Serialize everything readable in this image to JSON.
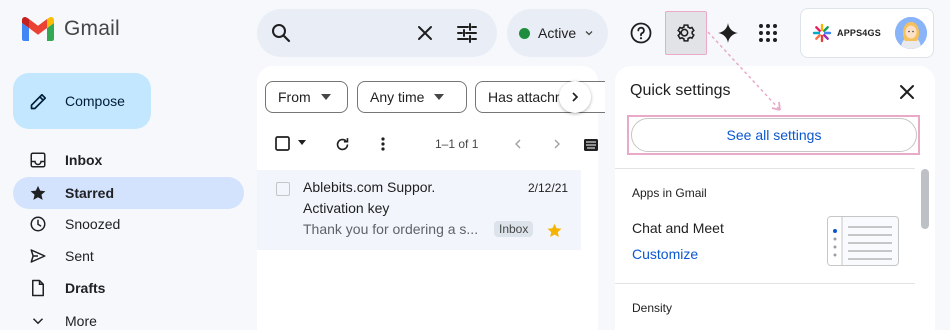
{
  "app": {
    "name": "Gmail"
  },
  "header": {
    "status_label": "Active",
    "account_label": "APPS4GS"
  },
  "sidebar": {
    "compose_label": "Compose",
    "items": [
      {
        "label": "Inbox",
        "icon": "inbox-icon",
        "bold": true
      },
      {
        "label": "Starred",
        "icon": "star-icon",
        "bold": true,
        "active": true
      },
      {
        "label": "Snoozed",
        "icon": "clock-icon"
      },
      {
        "label": "Sent",
        "icon": "send-icon"
      },
      {
        "label": "Drafts",
        "icon": "draft-icon",
        "bold": true
      },
      {
        "label": "More",
        "icon": "chevron-down-icon"
      }
    ]
  },
  "filters": {
    "from": "From",
    "time": "Any time",
    "attachment": "Has attachment"
  },
  "toolbar": {
    "pagination": "1–1 of 1"
  },
  "email": {
    "sender": "Ablebits.com Suppor.",
    "date": "2/12/21",
    "subject": "Activation key",
    "snippet": "Thank you for ordering a s...",
    "label": "Inbox",
    "starred": true
  },
  "quick_settings": {
    "title": "Quick settings",
    "see_all": "See all settings",
    "apps_section": "Apps in Gmail",
    "chat_meet": "Chat and Meet",
    "customize": "Customize",
    "density_section": "Density"
  },
  "colors": {
    "accent_blue": "#0b57d0",
    "highlight_pink": "#e9a9c8",
    "active_nav": "#d3e3fd",
    "compose_bg": "#c2e7ff",
    "star": "#f4b400",
    "status_green": "#1e8e3e"
  }
}
